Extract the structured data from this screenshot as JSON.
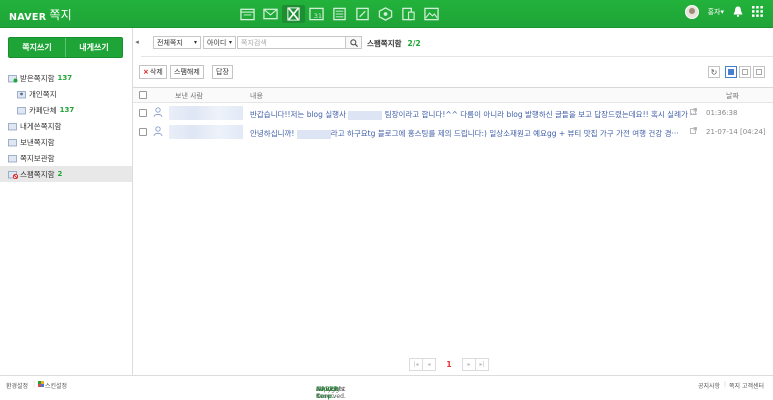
{
  "topbar": {
    "logo": "NAVER",
    "service": "쪽지",
    "apps": [
      "calendar-app-icon",
      "mail-icon",
      "memo-icon",
      "calendar-icon",
      "contacts-icon",
      "note-icon",
      "cafe-icon",
      "documents-icon",
      "photo-icon"
    ],
    "active_app_index": 2,
    "user_name": "홍자▾",
    "accent": "#1fa437"
  },
  "sidebar": {
    "write_button": "쪽지쓰기",
    "write_self_button": "내게쓰기",
    "tree": [
      {
        "label": "받은쪽지함",
        "count": "137",
        "sub": false
      },
      {
        "label": "개인쪽지",
        "count": "",
        "sub": true
      },
      {
        "label": "카페단체",
        "count": "137",
        "sub": true
      },
      {
        "label": "내게쓴쪽지함",
        "count": "",
        "sub": false
      },
      {
        "label": "보낸쪽지함",
        "count": "",
        "sub": false
      },
      {
        "label": "쪽지보관함",
        "count": "",
        "sub": false
      },
      {
        "label": "스팸쪽지함",
        "count": "2",
        "sub": false,
        "selected": true
      }
    ]
  },
  "search": {
    "filter": "전체쪽지",
    "field": "아이디",
    "placeholder": "쪽지검색"
  },
  "box": {
    "title": "스팸쪽지함",
    "count": "2/2"
  },
  "toolbar": {
    "delete": "삭제",
    "unspam": "스팸해제",
    "reply": "답장"
  },
  "table": {
    "col_sender": "보낸 사람",
    "col_content": "내용",
    "col_date": "날짜",
    "rows": [
      {
        "content_a": "반갑습니다!!저는 blog 실행사 ",
        "content_b": " 팀장이라고 합니다!^^ 다름이 아니라 blog 발행하신 글들을 보고 답장드렸는데요!! 혹시 실례가 ···",
        "date": "01:36:38"
      },
      {
        "content_a": "안녕하십니까! ",
        "content_b": "라고 하구요tg 블로그에 홍스팅를 제의 드립니다:) 일상소재원고 예요gg + 뷰티 맛집 가구 가전 여행 건강 경···",
        "date": "21-07-14 [04:24]"
      }
    ]
  },
  "pager": {
    "current": "1"
  },
  "footer": {
    "left1": "환경설정",
    "left2": "스킨설정",
    "copyright_pre": "Copyright ©",
    "brand": "NAVER Corp.",
    "copyright_post": "All Rights Reserved.",
    "right1": "공지사항",
    "right2": "쪽지 고객센터"
  }
}
